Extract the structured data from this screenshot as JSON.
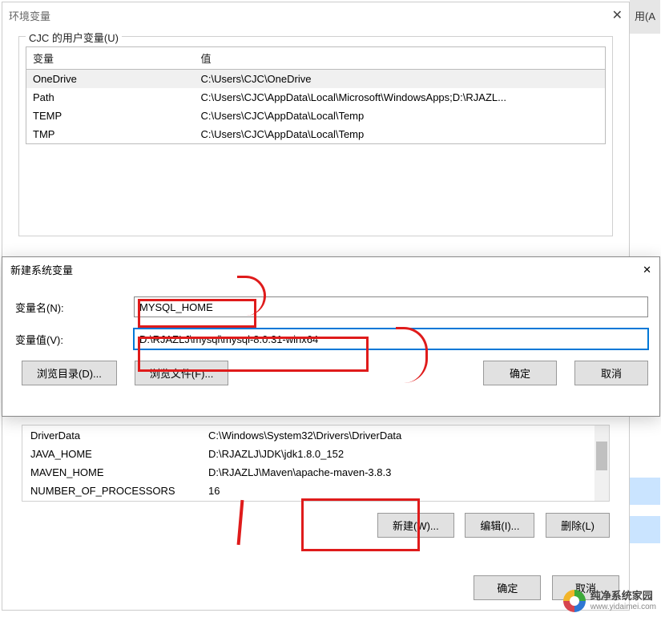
{
  "bg": {
    "tab": "用(A"
  },
  "envWin": {
    "title": "环境变量",
    "userGroup": "CJC 的用户变量(U)",
    "headers": {
      "var": "变量",
      "val": "值"
    },
    "userVars": [
      {
        "var": "OneDrive",
        "val": "C:\\Users\\CJC\\OneDrive",
        "sel": true
      },
      {
        "var": "Path",
        "val": "C:\\Users\\CJC\\AppData\\Local\\Microsoft\\WindowsApps;D:\\RJAZL..."
      },
      {
        "var": "TEMP",
        "val": "C:\\Users\\CJC\\AppData\\Local\\Temp"
      },
      {
        "var": "TMP",
        "val": "C:\\Users\\CJC\\AppData\\Local\\Temp"
      }
    ],
    "sysVars": [
      {
        "var": "DriverData",
        "val": "C:\\Windows\\System32\\Drivers\\DriverData"
      },
      {
        "var": "JAVA_HOME",
        "val": "D:\\RJAZLJ\\JDK\\jdk1.8.0_152"
      },
      {
        "var": "MAVEN_HOME",
        "val": "D:\\RJAZLJ\\Maven\\apache-maven-3.8.3"
      },
      {
        "var": "NUMBER_OF_PROCESSORS",
        "val": "16"
      }
    ],
    "newBtn": "新建(W)...",
    "editBtn": "编辑(I)...",
    "delBtn": "删除(L)",
    "okBtn": "确定",
    "cancelBtn": "取消"
  },
  "newVarDlg": {
    "title": "新建系统变量",
    "nameLabel": "变量名(N):",
    "nameValue": "MYSQL_HOME",
    "valueLabel": "变量值(V):",
    "valueValue": "D:\\RJAZLJ\\mysql\\mysql-8.0.31-winx64",
    "browseDir": "浏览目录(D)...",
    "browseFile": "浏览文件(F)...",
    "ok": "确定",
    "cancel": "取消"
  },
  "watermark": {
    "line1": "纯净系统家园",
    "line2": "www.yidaimei.com"
  }
}
